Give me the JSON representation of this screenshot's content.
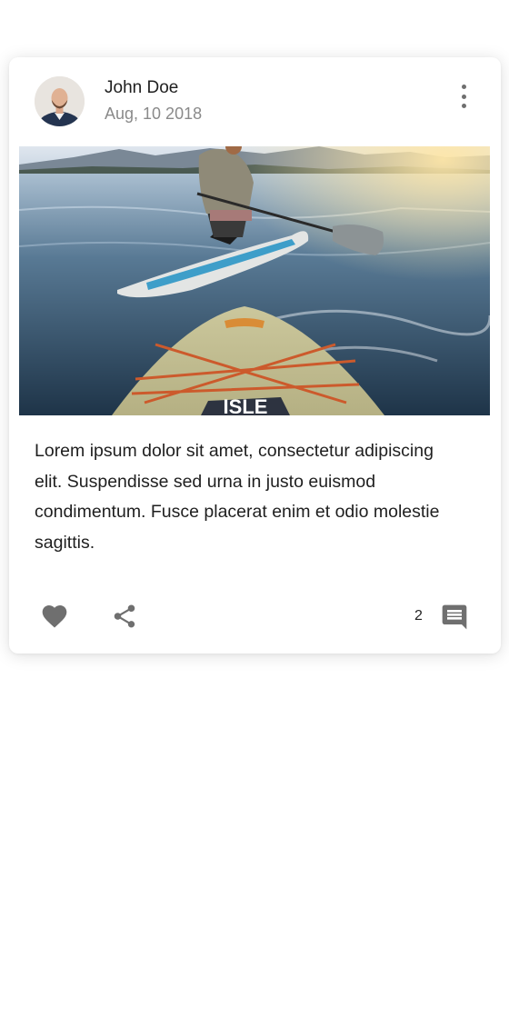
{
  "post": {
    "author": "John Doe",
    "date": "Aug, 10 2018",
    "body": "Lorem ipsum dolor sit amet, consectetur adipiscing elit. Suspendisse sed urna in justo euismod condimentum. Fusce placerat enim et odio molestie sagittis.",
    "board_text": "ISLE",
    "comment_count": "2"
  },
  "icons": {
    "like": "heart-icon",
    "share": "share-icon",
    "comment": "comment-icon",
    "more": "more-vertical-icon"
  },
  "colors": {
    "icon": "#6f6f6f",
    "muted_text": "#8a8a8a",
    "text": "#1f1f1f"
  }
}
